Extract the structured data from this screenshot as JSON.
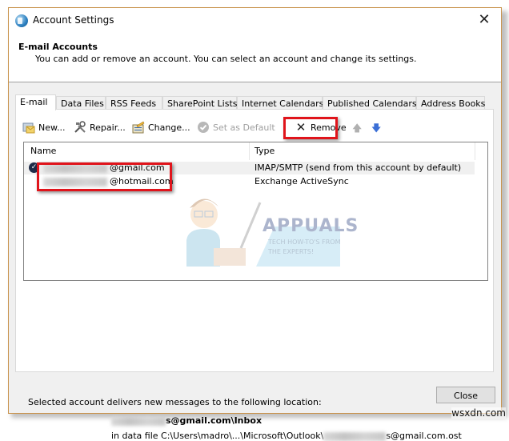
{
  "window": {
    "title": "Account Settings",
    "close_glyph": "✕"
  },
  "header": {
    "heading": "E-mail Accounts",
    "description": "You can add or remove an account. You can select an account and change its settings."
  },
  "tabs": [
    {
      "label": "E-mail",
      "active": true
    },
    {
      "label": "Data Files",
      "active": false
    },
    {
      "label": "RSS Feeds",
      "active": false
    },
    {
      "label": "SharePoint Lists",
      "active": false
    },
    {
      "label": "Internet Calendars",
      "active": false
    },
    {
      "label": "Published Calendars",
      "active": false
    },
    {
      "label": "Address Books",
      "active": false
    }
  ],
  "toolbar": {
    "new_label": "New...",
    "repair_label": "Repair...",
    "change_label": "Change...",
    "set_default_label": "Set as Default",
    "remove_label": "Remove",
    "remove_glyph": "✕",
    "move_up_glyph": "🡅",
    "move_down_glyph": "🡇"
  },
  "accounts_list": {
    "columns": [
      "Name",
      "Type"
    ],
    "rows": [
      {
        "name_suffix": "@gmail.com",
        "type": "IMAP/SMTP (send from this account by default)",
        "is_default": true,
        "selected": true
      },
      {
        "name_suffix": "@hotmail.com",
        "type": "Exchange ActiveSync",
        "is_default": false,
        "selected": false
      }
    ]
  },
  "watermark": {
    "brand": "APPUALS",
    "tagline_1": "TECH HOW-TO'S FROM",
    "tagline_2": "THE EXPERTS!"
  },
  "delivery": {
    "label": "Selected account delivers new messages to the following location:",
    "location_suffix": "s@gmail.com\\Inbox",
    "data_file_prefix": "in data file C:\\Users\\madro\\...\\Microsoft\\Outlook\\",
    "data_file_suffix": "s@gmail.com.ost"
  },
  "footer": {
    "close_label": "Close"
  },
  "site_watermark": "wsxdn.com",
  "colors": {
    "highlight_red": "#e0141b",
    "window_border": "#c9944e",
    "dialog_bg": "#f0f0f0"
  }
}
